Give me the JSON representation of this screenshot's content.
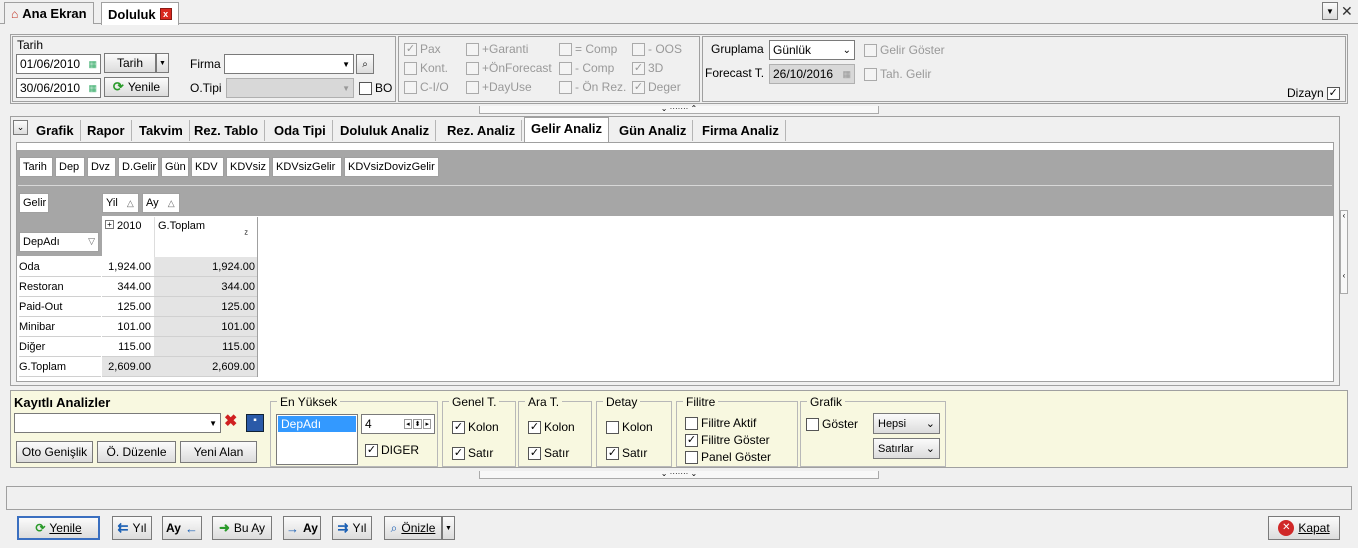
{
  "tabs": {
    "home": "Ana Ekran",
    "active": "Doluluk",
    "close": "x"
  },
  "filters": {
    "tarih_title": "Tarih",
    "date_from": "01/06/2010",
    "date_to": "30/06/2010",
    "tarih_btn": "Tarih",
    "yenile_btn": "Yenile",
    "firma_label": "Firma",
    "firma_value": "",
    "otipi_label": "O.Tipi",
    "bo_label": "BO"
  },
  "checks": [
    {
      "label": "Pax",
      "checked": true
    },
    {
      "label": "+Garanti",
      "checked": false
    },
    {
      "label": "= Comp",
      "checked": false
    },
    {
      "label": "- OOS",
      "checked": false
    },
    {
      "label": "Kont.",
      "checked": false
    },
    {
      "label": "+ÖnForecast",
      "checked": false
    },
    {
      "label": "- Comp",
      "checked": false
    },
    {
      "label": "3D",
      "checked": true
    },
    {
      "label": "C-I/O",
      "checked": false
    },
    {
      "label": "+DayUse",
      "checked": false
    },
    {
      "label": "- Ön Rez.",
      "checked": false
    },
    {
      "label": "Deger",
      "checked": true
    }
  ],
  "group": {
    "gruplama_label": "Gruplama",
    "gruplama_value": "Günlük",
    "forecast_label": "Forecast T.",
    "forecast_value": "26/10/2016",
    "gelir_goster": "Gelir Göster",
    "tah_gelir": "Tah. Gelir",
    "dizayn": "Dizayn"
  },
  "analysis_tabs": [
    "Grafik",
    "Rapor",
    "Takvim",
    "Rez. Tablo",
    "Oda Tipi",
    "Doluluk Analiz",
    "Rez. Analiz",
    "Gelir Analiz",
    "Gün Analiz",
    "Firma Analiz"
  ],
  "pivot": {
    "filter_fields": [
      "Tarih",
      "Dep",
      "Dvz",
      "D.Gelir",
      "Gün",
      "KDV",
      "KDVsiz",
      "KDVsizGelir",
      "KDVsizDovizGelir"
    ],
    "data_field": "Gelir",
    "col_fields": [
      "Yil",
      "Ay"
    ],
    "row_field": "DepAdı",
    "col_header_year": "2010",
    "col_header_total": "G.Toplam",
    "rows": [
      {
        "name": "Oda",
        "v2010": "1,924.00",
        "total": "1,924.00"
      },
      {
        "name": "Restoran",
        "v2010": "344.00",
        "total": "344.00"
      },
      {
        "name": "Paid-Out",
        "v2010": "125.00",
        "total": "125.00"
      },
      {
        "name": "Minibar",
        "v2010": "101.00",
        "total": "101.00"
      },
      {
        "name": "Diğer",
        "v2010": "115.00",
        "total": "115.00"
      },
      {
        "name": "G.Toplam",
        "v2010": "2,609.00",
        "total": "2,609.00"
      }
    ]
  },
  "saved": {
    "title": "Kayıtlı Analizler",
    "oto": "Oto Genişlik",
    "duzenle": "Ö. Düzenle",
    "yeni": "Yeni Alan"
  },
  "opts": {
    "en_yuksek": "En Yüksek",
    "en_yuksek_item": "DepAdı",
    "top_n": "4",
    "diger": "DIGER",
    "genel": "Genel T.",
    "ara": "Ara T.",
    "detay": "Detay",
    "kolon": "Kolon",
    "satir": "Satır",
    "filitre": "Filitre",
    "filitre_aktif": "Filitre Aktif",
    "filitre_goster": "Filitre Göster",
    "panel_goster": "Panel Göster",
    "grafik": "Grafik",
    "goster": "Göster",
    "hepsi": "Hepsi",
    "satirlar": "Satırlar"
  },
  "bottom": {
    "yenile": "Yenile",
    "yil_prev": "Yıl",
    "ay_prev": "Ay",
    "bu_ay": "Bu Ay",
    "ay_next": "Ay",
    "yil_next": "Yıl",
    "onizle": "Önizle",
    "kapat": "Kapat"
  }
}
